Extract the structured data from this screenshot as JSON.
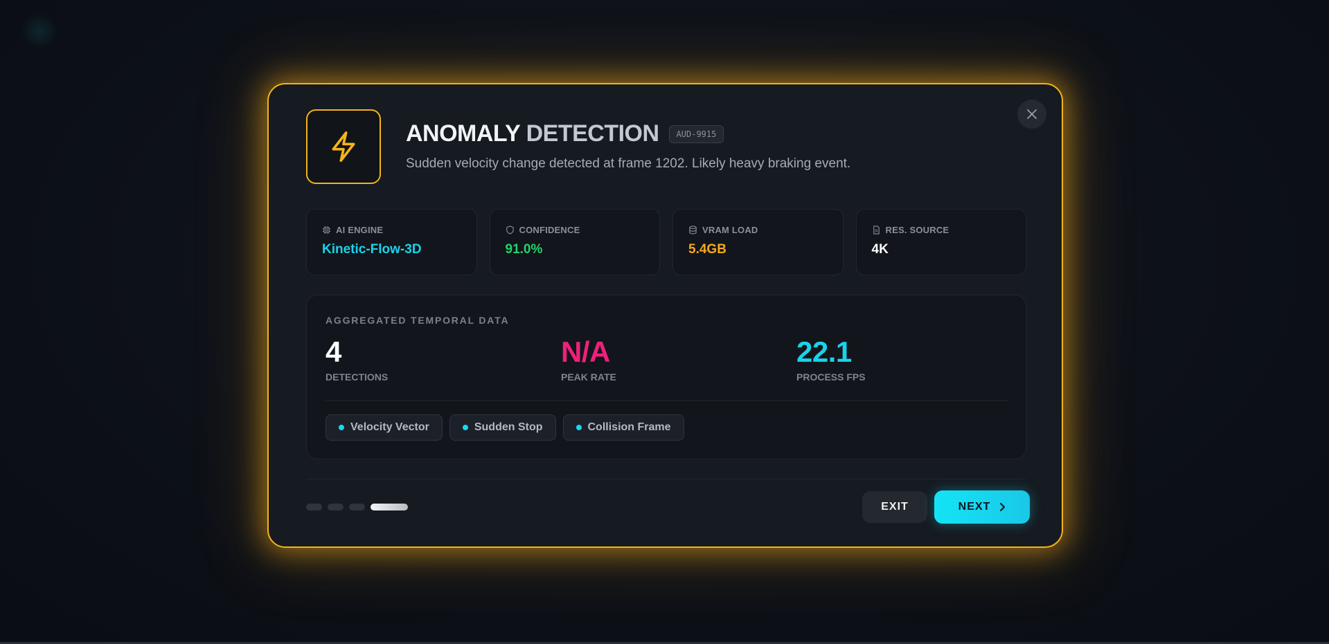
{
  "modal": {
    "title_part1": "ANOMALY",
    "title_part2": "DETECTION",
    "badge": "AUD-9915",
    "subtitle": "Sudden velocity change detected at frame 1202. Likely heavy braking event.",
    "icon": "lightning-bolt-icon",
    "accent_color": "#f5b418"
  },
  "stats": [
    {
      "label": "AI ENGINE",
      "value": "Kinetic-Flow-3D",
      "icon": "chip-icon",
      "color": "#19d3ea"
    },
    {
      "label": "CONFIDENCE",
      "value": "91.0%",
      "icon": "shield-icon",
      "color": "#22d36a"
    },
    {
      "label": "VRAM LOAD",
      "value": "5.4GB",
      "icon": "database-icon",
      "color": "#f5a91b"
    },
    {
      "label": "RES. SOURCE",
      "value": "4K",
      "icon": "file-icon",
      "color": "#ffffff"
    }
  ],
  "temporal": {
    "title": "AGGREGATED TEMPORAL DATA",
    "metrics": [
      {
        "value": "4",
        "label": "DETECTIONS",
        "color": "#ffffff"
      },
      {
        "value": "N/A",
        "label": "PEAK RATE",
        "color": "#f0207c"
      },
      {
        "value": "22.1",
        "label": "PROCESS FPS",
        "color": "#19d3ea"
      }
    ],
    "tags": [
      "Velocity Vector",
      "Sudden Stop",
      "Collision Frame"
    ]
  },
  "footer": {
    "exit_label": "EXIT",
    "next_label": "NEXT",
    "pager_total": 4,
    "pager_active": 4
  }
}
